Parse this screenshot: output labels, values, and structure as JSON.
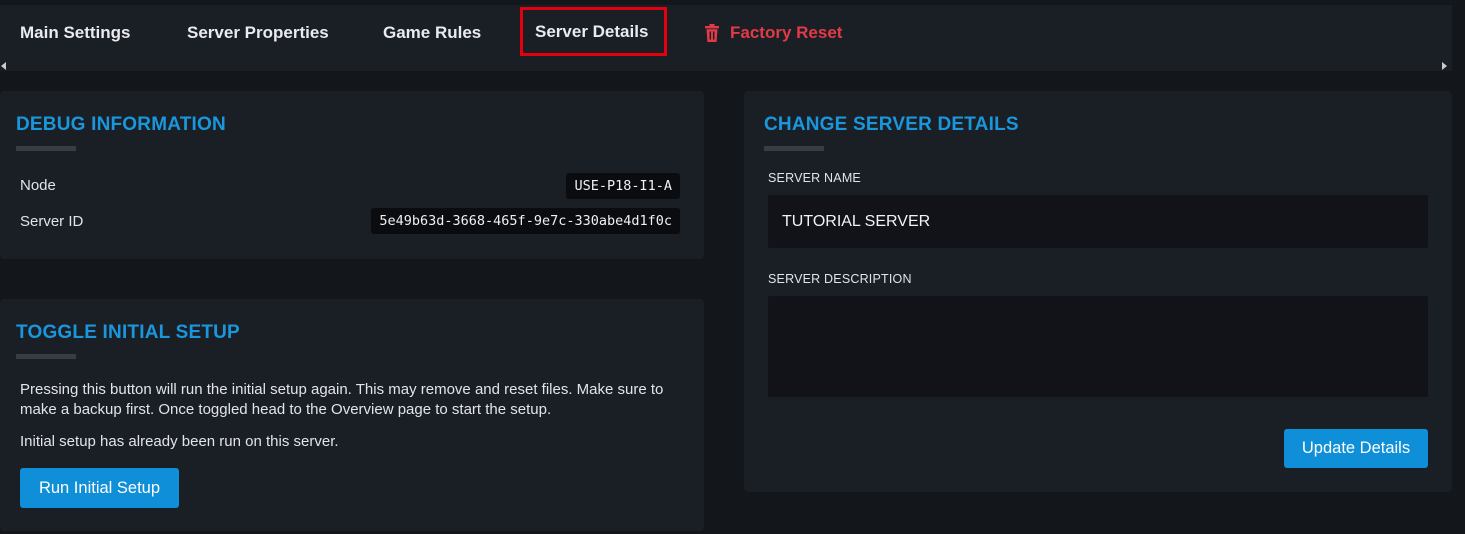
{
  "tabs": {
    "main_settings": "Main Settings",
    "server_properties": "Server Properties",
    "game_rules": "Game Rules",
    "server_details": "Server Details",
    "factory_reset": "Factory Reset"
  },
  "debug": {
    "title": "DEBUG INFORMATION",
    "node_label": "Node",
    "node_value": "USE-P18-I1-A",
    "server_id_label": "Server ID",
    "server_id_value": "5e49b63d-3668-465f-9e7c-330abe4d1f0c"
  },
  "setup": {
    "title": "TOGGLE INITIAL SETUP",
    "description": "Pressing this button will run the initial setup again. This may remove and reset files. Make sure to make a backup first. Once toggled head to the Overview page to start the setup.",
    "status": "Initial setup has already been run on this server.",
    "button": "Run Initial Setup"
  },
  "details": {
    "title": "CHANGE SERVER DETAILS",
    "name_label": "SERVER NAME",
    "name_value": "TUTORIAL SERVER",
    "description_label": "SERVER DESCRIPTION",
    "description_value": "",
    "button": "Update Details"
  },
  "colors": {
    "accent": "#1a97dc",
    "button": "#0e8fd8",
    "danger": "#e23a48",
    "highlight": "#e3000f"
  }
}
